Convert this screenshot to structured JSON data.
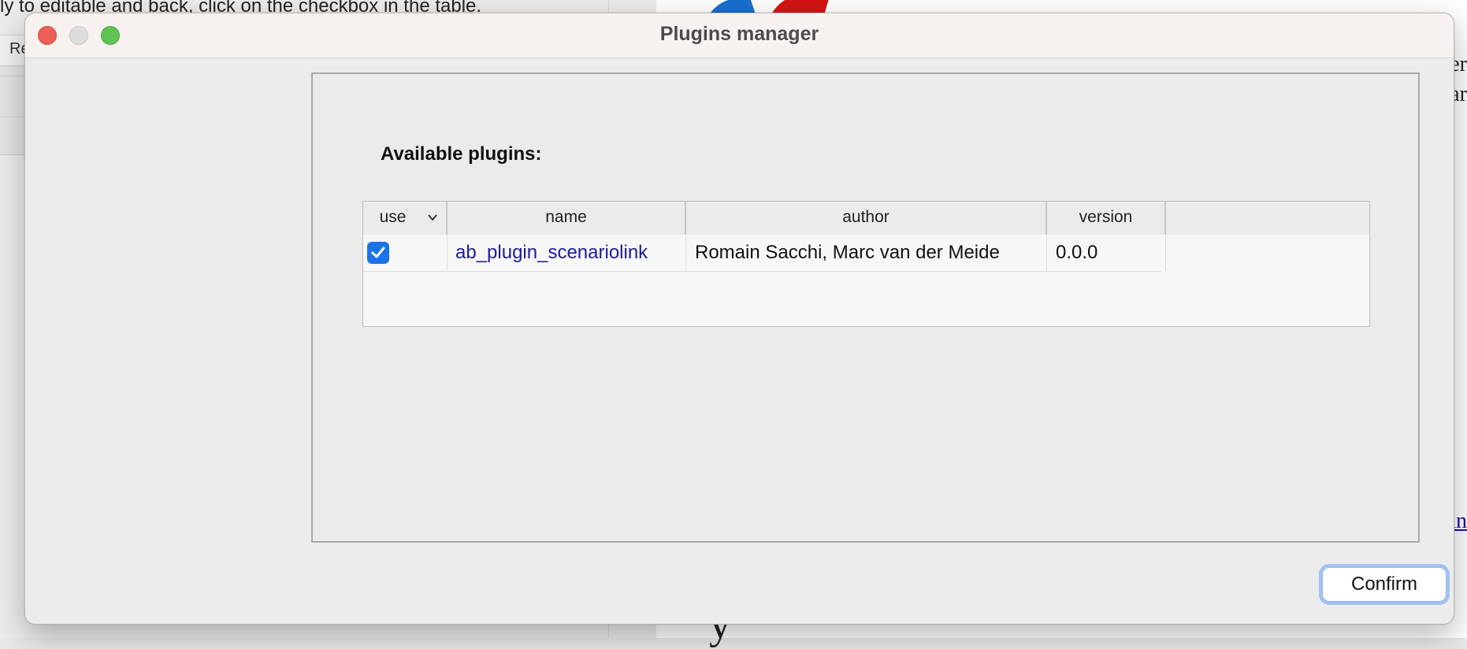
{
  "background": {
    "instruction_text": "ly to editable and back, click on the checkbox in the table.",
    "tab_label": "Re",
    "edge_text_1": "er",
    "edge_text_2": "ar",
    "edge_link": "nn",
    "bottom_serif_text": "y"
  },
  "window": {
    "title": "Plugins manager",
    "controls": {
      "close": "close-window",
      "minimize": "minimize-window",
      "maximize": "maximize-window"
    }
  },
  "plugins": {
    "heading": "Available plugins:",
    "columns": [
      "use",
      "name",
      "author",
      "version"
    ],
    "rows": [
      {
        "use": true,
        "name": "ab_plugin_scenariolink",
        "author": "Romain Sacchi, Marc van der Meide",
        "version": "0.0.0"
      }
    ]
  },
  "footer": {
    "confirm_label": "Confirm"
  },
  "colors": {
    "accent": "#1a73e8",
    "link": "#1c1ca0",
    "close": "#ee5f57",
    "maximize": "#5fc453",
    "focus_ring": "#9fc3f5"
  },
  "icons": {
    "sort": "chevron-down-icon",
    "check": "checkmark-icon"
  }
}
